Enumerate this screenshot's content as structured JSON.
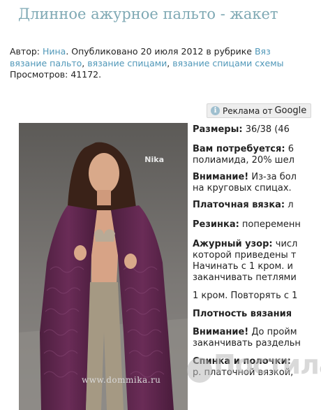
{
  "page": {
    "title": "Длинное ажурное пальто - жакет"
  },
  "meta": {
    "author_label": "Автор: ",
    "author": "Нина",
    "published_text": ". Опубликовано 20 июля 2012 в рубрике ",
    "category_1": "Вяз",
    "category_2": "вязание пальто",
    "category_3": "вязание спицами",
    "category_4": "вязание спицами схемы",
    "views_label": "Просмотров: ",
    "views": "41172."
  },
  "ad": {
    "label": "Реклама от",
    "brand": "Google"
  },
  "photo": {
    "watermark_logo": "Nika",
    "watermark_site": "www.dommika.ru"
  },
  "description": {
    "sizes_label": "Размеры:",
    "sizes_value": " 36/38 (46",
    "need_label": "Вам потребуется:",
    "need_value": " 6",
    "need_line2": "полиамида, 20% шел",
    "attention_label": "Внимание!",
    "attention_value": " Из-за бол",
    "attention_line2": "на круговых спицах.",
    "garter_label": "Платочная вязка:",
    "garter_value": " л",
    "rib_label": "Резинка:",
    "rib_value": " попеременн",
    "lace_label": "Ажурный узор:",
    "lace_value": " числ",
    "lace_line2": "которой приведены т",
    "lace_line3": "Начинать с 1 кром. и",
    "lace_line4": "заканчивать петлями",
    "lace_line5": "1 кром. Повторять с 1",
    "gauge_label": "Плотность вязания",
    "attention2_label": "Внимание!",
    "attention2_value": " До пройм",
    "attention2_line2": "заканчивать раздельн",
    "back_label": "Спинка и полочки:",
    "back_line2": "р. платочной вязкой,"
  },
  "watermark": {
    "text": "Постила"
  }
}
